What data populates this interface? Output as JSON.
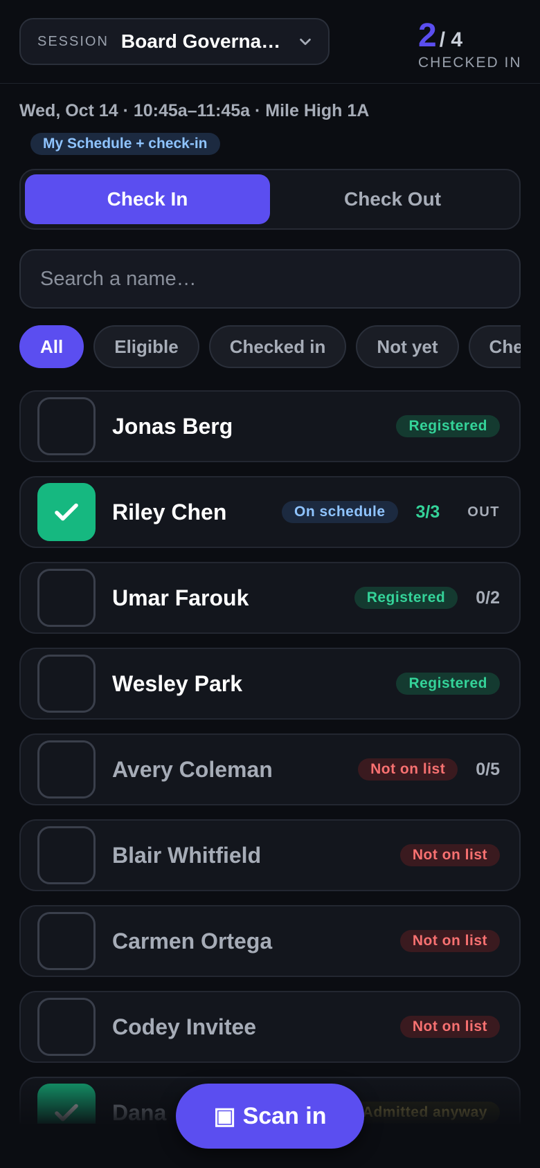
{
  "header": {
    "session_label": "SESSION",
    "session_name": "Board Governa…",
    "checked_in_count": "2",
    "checked_in_total": "/ 4",
    "checked_in_caption": "CHECKED IN"
  },
  "session_meta": "Wed, Oct 14 · 10:45a–11:45a · Mile High 1A",
  "schedule_tag": "My Schedule + check-in",
  "mode_tabs": [
    {
      "label": "Check In",
      "active": true
    },
    {
      "label": "Check Out",
      "active": false
    }
  ],
  "search": {
    "placeholder": "Search a name…",
    "value": ""
  },
  "filters": [
    {
      "label": "All",
      "active": true
    },
    {
      "label": "Eligible",
      "active": false
    },
    {
      "label": "Checked in",
      "active": false
    },
    {
      "label": "Not yet",
      "active": false
    },
    {
      "label": "Checked out",
      "active": false
    }
  ],
  "attendees": [
    {
      "name": "Jonas Berg",
      "badge": "Registered",
      "badge_type": "registered",
      "count": "",
      "out": "",
      "checked": false,
      "muted": false
    },
    {
      "name": "Riley Chen",
      "badge": "On schedule",
      "badge_type": "schedule",
      "count": "3/3",
      "out": "OUT",
      "checked": true,
      "muted": false
    },
    {
      "name": "Umar Farouk",
      "badge": "Registered",
      "badge_type": "registered",
      "count": "0/2",
      "out": "",
      "checked": false,
      "muted": false
    },
    {
      "name": "Wesley Park",
      "badge": "Registered",
      "badge_type": "registered",
      "count": "",
      "out": "",
      "checked": false,
      "muted": false
    },
    {
      "name": "Avery Coleman",
      "badge": "Not on list",
      "badge_type": "notlist",
      "count": "0/5",
      "out": "",
      "checked": false,
      "muted": true
    },
    {
      "name": "Blair Whitfield",
      "badge": "Not on list",
      "badge_type": "notlist",
      "count": "",
      "out": "",
      "checked": false,
      "muted": true
    },
    {
      "name": "Carmen Ortega",
      "badge": "Not on list",
      "badge_type": "notlist",
      "count": "",
      "out": "",
      "checked": false,
      "muted": true
    },
    {
      "name": "Codey Invitee",
      "badge": "Not on list",
      "badge_type": "notlist",
      "count": "",
      "out": "",
      "checked": false,
      "muted": true
    },
    {
      "name": "Dana",
      "badge": "Admitted anyway",
      "badge_type": "admitted",
      "count": "",
      "out": "",
      "checked": true,
      "muted": true
    }
  ],
  "scan_button": {
    "icon": "scan-square-icon",
    "glyph": "▣",
    "label": "Scan in"
  },
  "colors": {
    "accent": "#5b4ef0",
    "success": "#16b880",
    "registered": "#34d399",
    "schedule": "#8fc4ff",
    "not_on_list": "#f87171",
    "background": "#0b0d12"
  }
}
